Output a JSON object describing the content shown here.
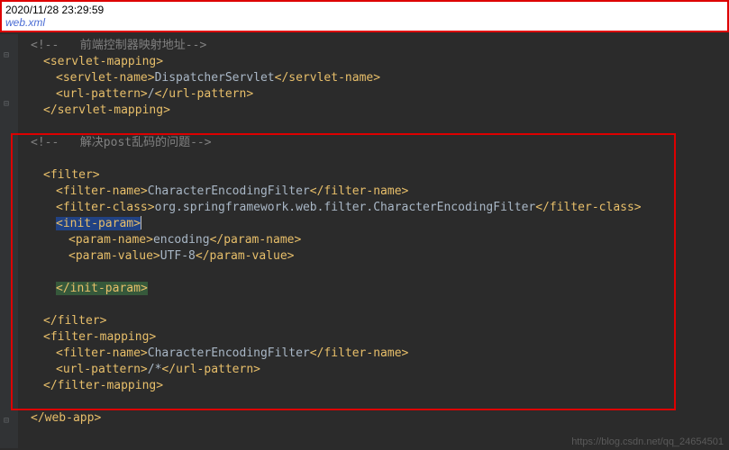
{
  "titlebar": {
    "timestamp": "2020/11/28 23:29:59",
    "filename": "web.xml"
  },
  "code": {
    "c1": "<!--   前端控制器映射地址-->",
    "sm_open": "servlet-mapping",
    "sn_open": "servlet-name",
    "sn_val": "DispatcherServlet",
    "sn_close": "servlet-name",
    "up_open": "url-pattern",
    "up_val1": "/",
    "up_close": "url-pattern",
    "sm_close": "servlet-mapping",
    "c2": "<!--   解决post乱码的问题-->",
    "f_open": "filter",
    "fn_open": "filter-name",
    "fn_val": "CharacterEncodingFilter",
    "fn_close": "filter-name",
    "fc_open": "filter-class",
    "fc_val": "org.springframework.web.filter.CharacterEncodingFilter",
    "fc_close": "filter-class",
    "ip_open": "init-param",
    "pn_open": "param-name",
    "pn_val": "encoding",
    "pn_close": "param-name",
    "pv_open": "param-value",
    "pv_val": "UTF-8",
    "pv_close": "param-value",
    "ip_close": "init-param",
    "f_close": "filter",
    "fm_open": "filter-mapping",
    "fn2_val": "CharacterEncodingFilter",
    "up_val2": "/*",
    "fm_close": "filter-mapping",
    "wa_close": "web-app"
  },
  "watermark": "https://blog.csdn.net/qq_24654501"
}
